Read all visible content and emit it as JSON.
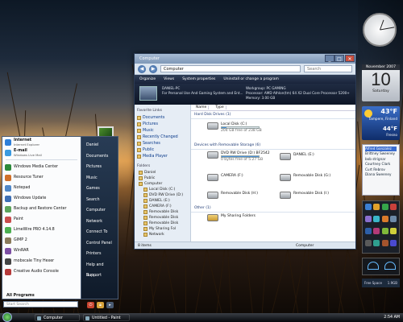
{
  "window": {
    "title": "Computer",
    "address": "Computer",
    "search_placeholder": "Search",
    "toolbar": [
      "Organize",
      "Views",
      "System properties",
      "Uninstall or change a program"
    ],
    "details": {
      "name": "DANIEL-PC",
      "workgroup": "Workgroup: PC GAMING",
      "processor": "Processor: AMD Athlon(tm) 64 X2 Dual Core Processor 5200+",
      "memory": "Memory: 3.00 GB",
      "desc": "For Personal Use And Gaming System and Ent..."
    },
    "nav": {
      "favorites_heading": "Favorite Links",
      "favorites": [
        "Documents",
        "Pictures",
        "Music",
        "Recently Changed",
        "Searches",
        "Public",
        "Media Player"
      ],
      "folders_heading": "Folders",
      "tree": [
        "Daniel",
        "Public",
        "Computer",
        "Local Disk (C:)",
        "DVD RW Drive (D:)",
        "DANIEL (E:)",
        "CAMERA (F:)",
        "Removable Disk",
        "Removable Disk",
        "Removable Disk",
        "My Sharing Fol",
        "Network"
      ]
    },
    "columns": [
      "Name",
      "Type"
    ],
    "groups": {
      "hdd": "Hard Disk Drives (1)",
      "removable": "Devices with Removable Storage (6)",
      "other": "Other (1)"
    },
    "drives": {
      "c": {
        "name": "Local Disk (C:)",
        "free": "204 GB free of 238 GB",
        "used_pct": 14
      },
      "dvd": {
        "name": "DVD RW Drive (D:) BF2542",
        "free": "0 bytes free of 5.27 GB",
        "used_pct": 100
      },
      "e": {
        "name": "DANIEL (E:)"
      },
      "f": {
        "name": "CAMERA (F:)"
      },
      "g": {
        "name": "Removable Disk (G:)"
      },
      "h": {
        "name": "Removable Disk (H:)"
      },
      "i": {
        "name": "Removable Disk (I:)"
      },
      "sharing": {
        "name": "My Sharing Folders"
      }
    },
    "status": {
      "items": "8 items",
      "location": "Computer"
    }
  },
  "start_menu": {
    "pinned": [
      {
        "label": "Internet",
        "sub": "Internet Explorer",
        "color": "#2f7fd8"
      },
      {
        "label": "E-mail",
        "sub": "Windows Live Mail",
        "color": "#3a9ae0"
      }
    ],
    "recent": [
      {
        "label": "Windows Media Center",
        "color": "#2c8a3a"
      },
      {
        "label": "Resource Tuner",
        "color": "#d0702a"
      },
      {
        "label": "Notepad",
        "color": "#4f87c8"
      },
      {
        "label": "Windows Update",
        "color": "#3d6fb5"
      },
      {
        "label": "Backup and Restore Center",
        "color": "#5ba35a"
      },
      {
        "label": "Paint",
        "color": "#c94c4c"
      },
      {
        "label": "LimeWire PRO 4.14.8",
        "color": "#4caf50"
      },
      {
        "label": "GIMP 2",
        "color": "#8a7a5a"
      },
      {
        "label": "WinRAR",
        "color": "#7d4ea3"
      },
      {
        "label": "mobscale Tiny Hexer",
        "color": "#444444"
      },
      {
        "label": "Creative Audio Console",
        "color": "#b53a3a"
      }
    ],
    "all_programs": "All Programs",
    "search_placeholder": "Start Search",
    "right": [
      "Daniel",
      "Documents",
      "Pictures",
      "Music",
      "Games",
      "Search",
      "Computer",
      "Network",
      "Connect To",
      "Control Panel",
      "Printers",
      "Help and Support",
      "Run..."
    ]
  },
  "taskbar": {
    "buttons": [
      "Computer",
      "Untitled - Paint"
    ],
    "clock": "2:54 AM"
  },
  "sidebar": {
    "calendar": {
      "month": "November 2007",
      "day": "10",
      "weekday": "Saturday"
    },
    "weather": {
      "temp1": "43°F",
      "temp2": "44°F",
      "city": "Tampere, Finland",
      "cond": "Fresno"
    },
    "contacts": [
      "Alfred Gonzalez",
      "Brittney Sweeney",
      "bob strignar",
      "Courtney Clark",
      "Curt Rebrov",
      "Diana Sweeney"
    ],
    "disk": {
      "label": "Free Space",
      "value": "1.9GB"
    },
    "launch_colors": [
      "#3b7fd3",
      "#e0a02a",
      "#35a54a",
      "#c8413b",
      "#8a6fcf",
      "#3ab6c9",
      "#d97a2b",
      "#6d8aa8",
      "#2d5fa8",
      "#b33a78",
      "#7fb83a",
      "#cfcf3a",
      "#5a5a5a",
      "#2f9f8f",
      "#a5542d",
      "#4a4ad0"
    ]
  }
}
